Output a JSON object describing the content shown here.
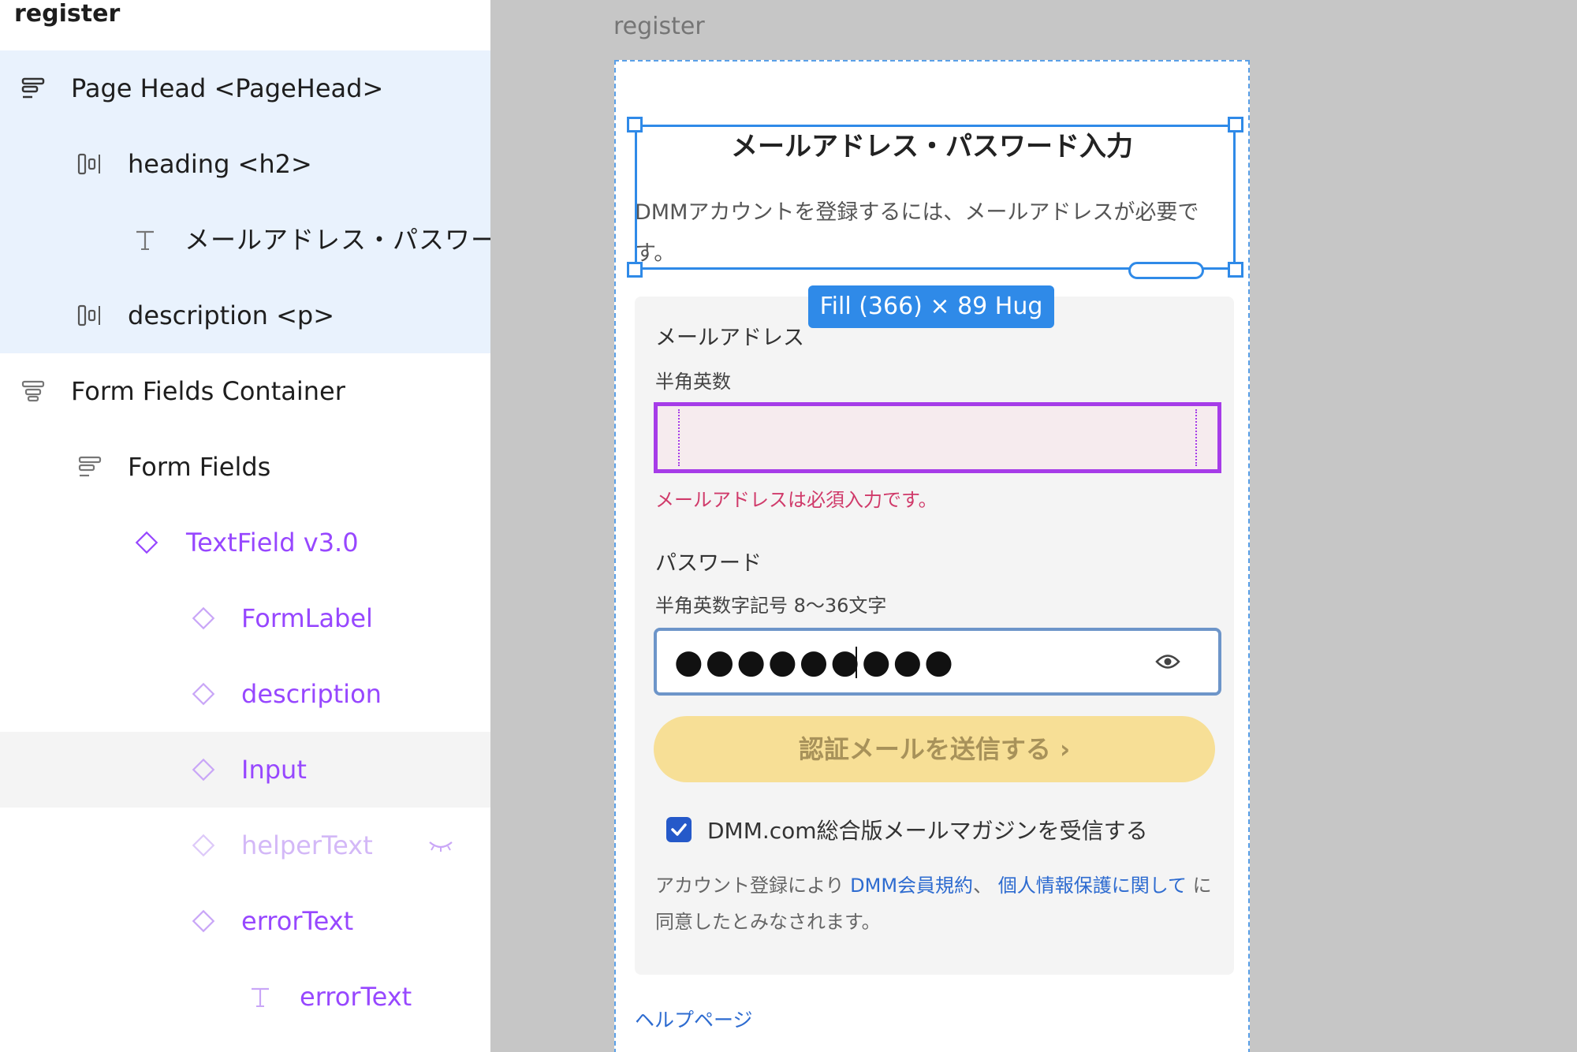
{
  "layers": {
    "page_name": "register",
    "rows": [
      {
        "label": "Page Head <PageHead>"
      },
      {
        "label": "heading <h2>"
      },
      {
        "label": "メールアドレス・パスワー"
      },
      {
        "label": "description <p>"
      },
      {
        "label": "Form Fields Container"
      },
      {
        "label": "Form Fields"
      },
      {
        "label": "TextField v3.0"
      },
      {
        "label": "FormLabel"
      },
      {
        "label": "description"
      },
      {
        "label": "Input"
      },
      {
        "label": "helperText"
      },
      {
        "label": "errorText"
      },
      {
        "label": "errorText"
      }
    ]
  },
  "canvas": {
    "frame_title": "register",
    "heading": "メールアドレス・パスワード入力",
    "description": "DMMアカウントを登録するには、メールアドレスが必要です。",
    "size_badge": "Fill (366) × 89 Hug",
    "email": {
      "label": "メールアドレス",
      "description": "半角英数",
      "value": "",
      "error": "メールアドレスは必須入力です。"
    },
    "password": {
      "label": "パスワード",
      "description": "半角英数字記号 8〜36文字",
      "value_masked": "●●●●●●●●●"
    },
    "submit_label": "認証メールを送信する ›",
    "newsletter": {
      "label": "DMM.com総合版メールマガジンを受信する",
      "checked": true
    },
    "terms": {
      "prefix": "アカウント登録により ",
      "link1": "DMM会員規約",
      "sep": "、 ",
      "link2": "個人情報保護に関して",
      "suffix": " に同意したとみなされます。"
    },
    "help_link": "ヘルプページ"
  },
  "colors": {
    "selection": "#2f8ae8",
    "component": "#9747ff",
    "error": "#d03a6a",
    "cta": "#f7df96",
    "link": "#2d6bd0"
  }
}
